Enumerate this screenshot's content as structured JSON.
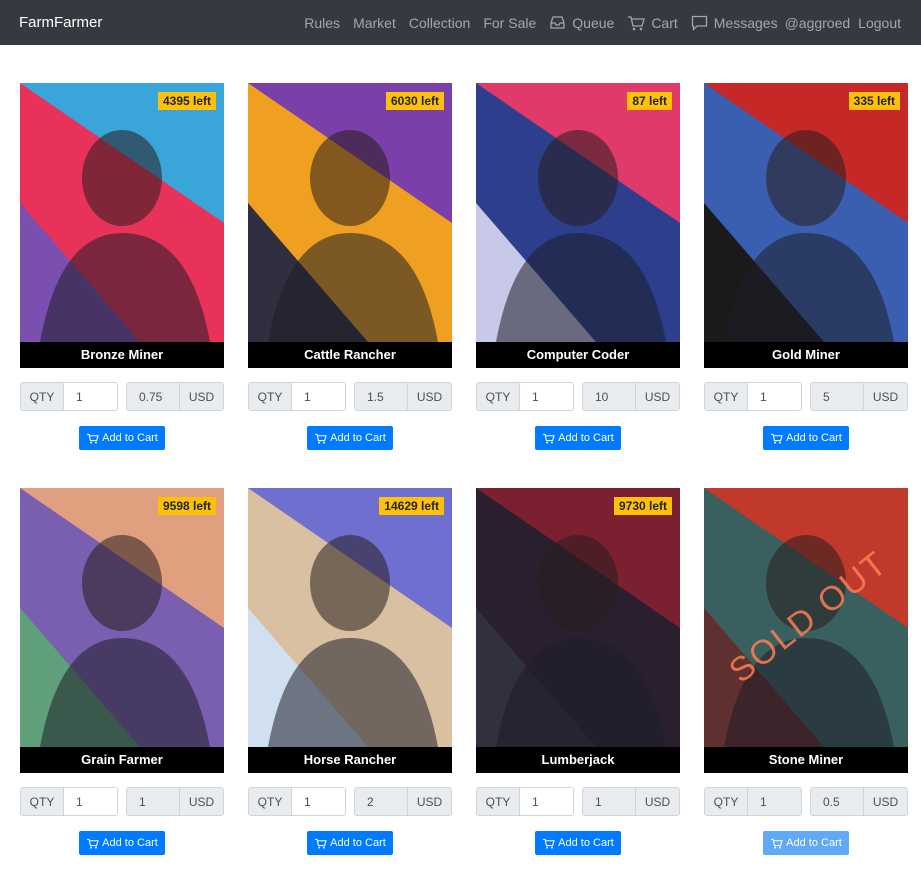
{
  "nav": {
    "brand": "FarmFarmer",
    "links": [
      "Rules",
      "Market",
      "Collection",
      "For Sale"
    ],
    "queue": "Queue",
    "cart": "Cart",
    "messages": "Messages",
    "user": "@aggroed",
    "logout": "Logout"
  },
  "labels": {
    "qty": "QTY",
    "currency": "USD",
    "add_to_cart": "Add to Cart",
    "sold_out": "SOLD OUT"
  },
  "cards": [
    {
      "name": "Bronze Miner",
      "left": "4395 left",
      "qty": "1",
      "price": "0.75",
      "colors": [
        "#e8325a",
        "#3aa5d8",
        "#7a4fb0"
      ]
    },
    {
      "name": "Cattle Rancher",
      "left": "6030 left",
      "qty": "1",
      "price": "1.5",
      "colors": [
        "#f0a020",
        "#7a3fa8",
        "#2f2f3f"
      ]
    },
    {
      "name": "Computer Coder",
      "left": "87 left",
      "qty": "1",
      "price": "10",
      "colors": [
        "#2c3e8c",
        "#e03a6a",
        "#c8c8e8"
      ]
    },
    {
      "name": "Gold Miner",
      "left": "335 left",
      "qty": "1",
      "price": "5",
      "colors": [
        "#3a5fb0",
        "#c62828",
        "#1a1a1a"
      ]
    },
    {
      "name": "Grain Farmer",
      "left": "9598 left",
      "qty": "1",
      "price": "1",
      "colors": [
        "#7a5fb0",
        "#e0a080",
        "#5f9f7a"
      ]
    },
    {
      "name": "Horse Rancher",
      "left": "14629 left",
      "qty": "1",
      "price": "2",
      "colors": [
        "#d8c0a0",
        "#6f6fd0",
        "#d0e0f0"
      ]
    },
    {
      "name": "Lumberjack",
      "left": "9730 left",
      "qty": "1",
      "price": "1",
      "colors": [
        "#2a1f2f",
        "#7a2030",
        "#30303f"
      ]
    },
    {
      "name": "Stone Miner",
      "left": "",
      "qty": "1",
      "price": "0.5",
      "sold_out": true,
      "colors": [
        "#3a5f5f",
        "#c0392b",
        "#5f3030"
      ]
    }
  ]
}
